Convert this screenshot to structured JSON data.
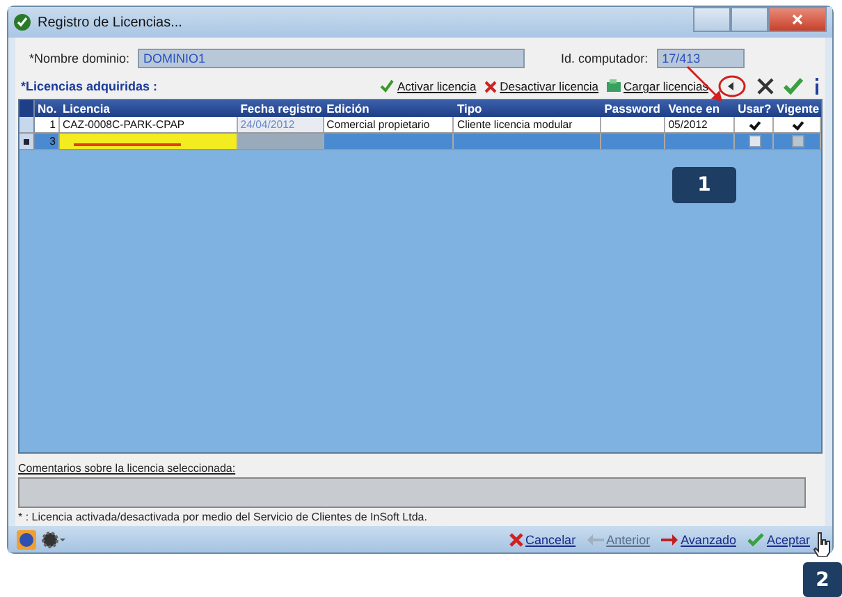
{
  "window": {
    "title": "Registro de Licencias..."
  },
  "fields": [
    {
      "label": "*Nombre dominio:",
      "value": "DOMINIO1",
      "kind": "wide"
    },
    {
      "label": "Id. computador:",
      "value": "17/413",
      "kind": "narrow"
    }
  ],
  "section_label": "*Licencias adquiridas :",
  "toolbar": [
    {
      "label": "Activar licencia",
      "kind": "check"
    },
    {
      "label": "Desactivar licencia",
      "kind": "cross"
    },
    {
      "label": "Cargar licencias",
      "kind": "load"
    }
  ],
  "table": {
    "columns": [
      "No.",
      "Licencia",
      "Fecha registro",
      "Edición",
      "Tipo",
      "Password",
      "Vence en",
      "Usar?",
      "Vigente"
    ],
    "rows": [
      {
        "selected": false,
        "highlighted": false,
        "cells": [
          "1",
          "CAZ-0008C-PARK-CPAP",
          "24/04/2012",
          "Comercial propietario",
          "Cliente licencia modular",
          "",
          "05/2012"
        ],
        "usar": true,
        "vigente": true
      },
      {
        "selected": true,
        "highlighted": true,
        "cells": [
          "3",
          "",
          "",
          "",
          "",
          "",
          ""
        ],
        "usar": false,
        "vigente": false
      }
    ]
  },
  "comments": {
    "label": "Comentarios sobre la licencia seleccionada:"
  },
  "footnote": "* : Licencia activada/desactivada por medio del Servicio de Clientes de InSoft Ltda.",
  "buttons": [
    {
      "label": "Cancelar",
      "kind": "cancel",
      "disabled": false
    },
    {
      "label": "Anterior",
      "kind": "back",
      "disabled": true
    },
    {
      "label": "Avanzado",
      "kind": "next",
      "disabled": false
    },
    {
      "label": "Aceptar",
      "kind": "ok",
      "disabled": false
    }
  ],
  "callouts": [
    "1",
    "2"
  ]
}
